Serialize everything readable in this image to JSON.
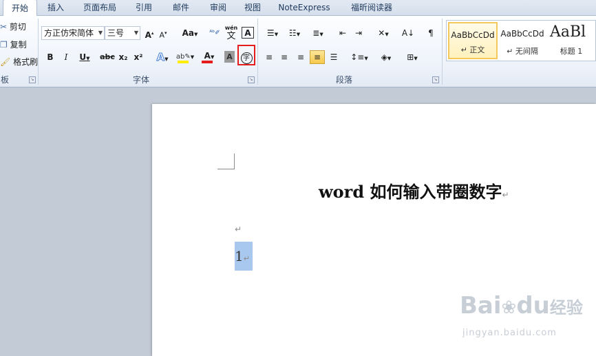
{
  "tabs": [
    {
      "label": "开始",
      "active": true
    },
    {
      "label": "插入"
    },
    {
      "label": "页面布局"
    },
    {
      "label": "引用"
    },
    {
      "label": "邮件"
    },
    {
      "label": "审阅"
    },
    {
      "label": "视图"
    },
    {
      "label": "NoteExpress"
    },
    {
      "label": "福昕阅读器"
    }
  ],
  "clipboard": {
    "cut": "剪切",
    "copy": "复制",
    "format_painter": "格式刷",
    "group_label": "板"
  },
  "font": {
    "font_name": "方正仿宋简体",
    "font_size": "三号",
    "change_case": "Aa",
    "bold": "B",
    "italic": "I",
    "underline": "U",
    "strikethrough": "abc",
    "subscript": "x₂",
    "superscript": "x²",
    "phonetic_guide": "wén",
    "phonetic_char": "文",
    "char_border": "A",
    "enclose_char": "字",
    "group_label": "字体"
  },
  "paragraph": {
    "group_label": "段落"
  },
  "styles": [
    {
      "preview": "AaBbCcDd",
      "name": "↵ 正文",
      "selected": true
    },
    {
      "preview": "AaBbCcDd",
      "name": "↵ 无间隔"
    },
    {
      "preview": "AaBl",
      "name": "标题 1"
    }
  ],
  "document": {
    "title": "word 如何输入带圈数字",
    "para_mark": "↵",
    "number_text": "1"
  },
  "watermark": {
    "brand": "Bai",
    "brand2": "du",
    "brand_cn": "经验",
    "url": "jingyan.baidu.com"
  },
  "colors": {
    "highlight_box": "#e51c1c",
    "selection": "#a9c8ef",
    "font_color_bar": "#e51c1c",
    "highlight_color_bar": "#ffee00"
  }
}
